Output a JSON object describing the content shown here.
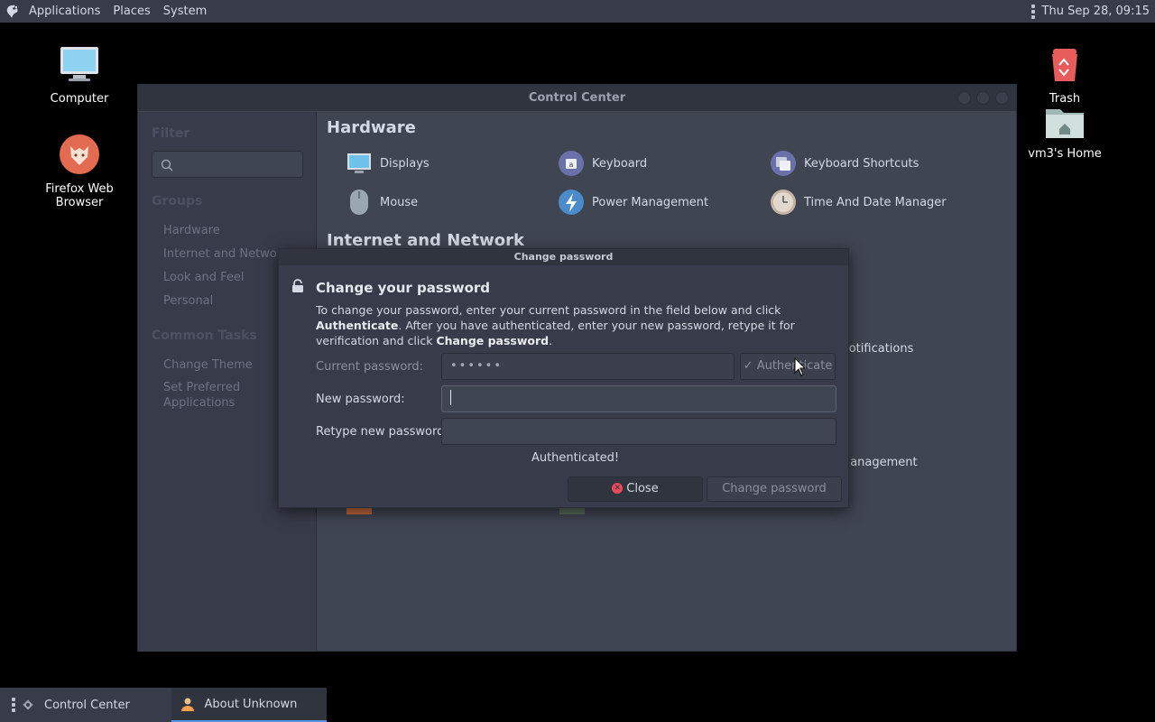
{
  "top_panel": {
    "menus": [
      "Applications",
      "Places",
      "System"
    ],
    "clock": "Thu Sep 28, 09:15"
  },
  "desktop": {
    "icons": [
      {
        "label": "Computer",
        "icon": "computer-icon"
      },
      {
        "label": "Firefox Web Browser",
        "icon": "firefox-icon"
      },
      {
        "label": "Trash",
        "icon": "trash-icon"
      },
      {
        "label": "vm3's Home",
        "icon": "home-folder-icon"
      }
    ]
  },
  "control_center": {
    "title": "Control Center",
    "sidebar": {
      "filter_heading": "Filter",
      "groups_heading": "Groups",
      "groups": [
        "Hardware",
        "Internet and Network",
        "Look and Feel",
        "Personal"
      ],
      "tasks_heading": "Common Tasks",
      "tasks": [
        "Change Theme",
        "Set Preferred Applications"
      ]
    },
    "sections": [
      {
        "title": "Hardware",
        "items": [
          "Displays",
          "Keyboard",
          "Keyboard Shortcuts",
          "Mouse",
          "Power Management",
          "Time And Date Manager"
        ]
      },
      {
        "title": "Internet and Network",
        "items": [
          "Notifications",
          "Management"
        ]
      }
    ]
  },
  "dialog": {
    "window_title": "Change password",
    "heading": "Change your password",
    "desc_1": "To change your password, enter your current password in the field below and click ",
    "desc_bold_1": "Authenticate",
    "desc_2": ". After you have authenticated, enter your new password, retype it for verification and click ",
    "desc_bold_2": "Change password",
    "desc_3": ".",
    "current_label": "Current password:",
    "current_value": "••••••",
    "authenticate_label": "Authenticate",
    "new_label": "New password:",
    "new_value": "",
    "retype_label": "Retype new password:",
    "retype_value": "",
    "status": "Authenticated!",
    "close_label": "Close",
    "change_label": "Change password"
  },
  "taskbar": {
    "tasks": [
      {
        "label": "Control Center",
        "icon": "control-center-icon",
        "active": false
      },
      {
        "label": "About Unknown",
        "icon": "user-icon",
        "active": true
      }
    ]
  },
  "colors": {
    "accent": "#5294e2",
    "panel": "#383c4a",
    "window_bg": "#404552",
    "error": "#e74b5b"
  }
}
